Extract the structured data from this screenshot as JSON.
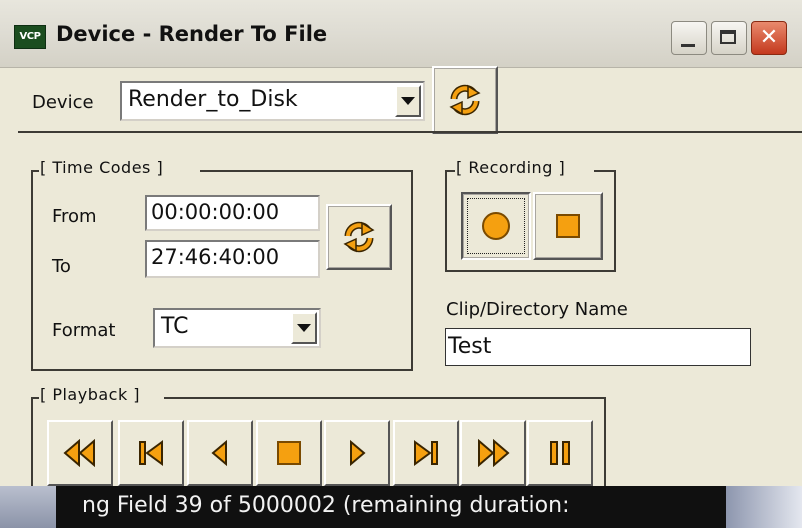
{
  "window": {
    "app_icon_text": "VCP",
    "title": "Device - Render To File",
    "close_glyph": "✕"
  },
  "device": {
    "label": "Device",
    "selected": "Render_to_Disk"
  },
  "time_codes": {
    "title": "[ Time Codes ]",
    "from_label": "From",
    "from_value": "00:00:00:00",
    "to_label": "To",
    "to_value": "27:46:40:00",
    "format_label": "Format",
    "format_value": "TC"
  },
  "recording": {
    "title": "[ Recording ]"
  },
  "clip": {
    "label": "Clip/Directory Name",
    "value": "Test"
  },
  "playback": {
    "title": "[ Playback ]"
  },
  "status": {
    "text": "ng Field 39 of 5000002 (remaining duration:"
  },
  "colors": {
    "accent_orange": "#f5a010",
    "window_bg": "#ece9d8"
  },
  "icons": [
    "refresh-icon",
    "record-icon",
    "stop-icon",
    "fast-rewind-icon",
    "skip-start-icon",
    "step-back-icon",
    "stop-icon",
    "play-icon",
    "skip-end-icon",
    "fast-forward-icon",
    "pause-icon"
  ]
}
